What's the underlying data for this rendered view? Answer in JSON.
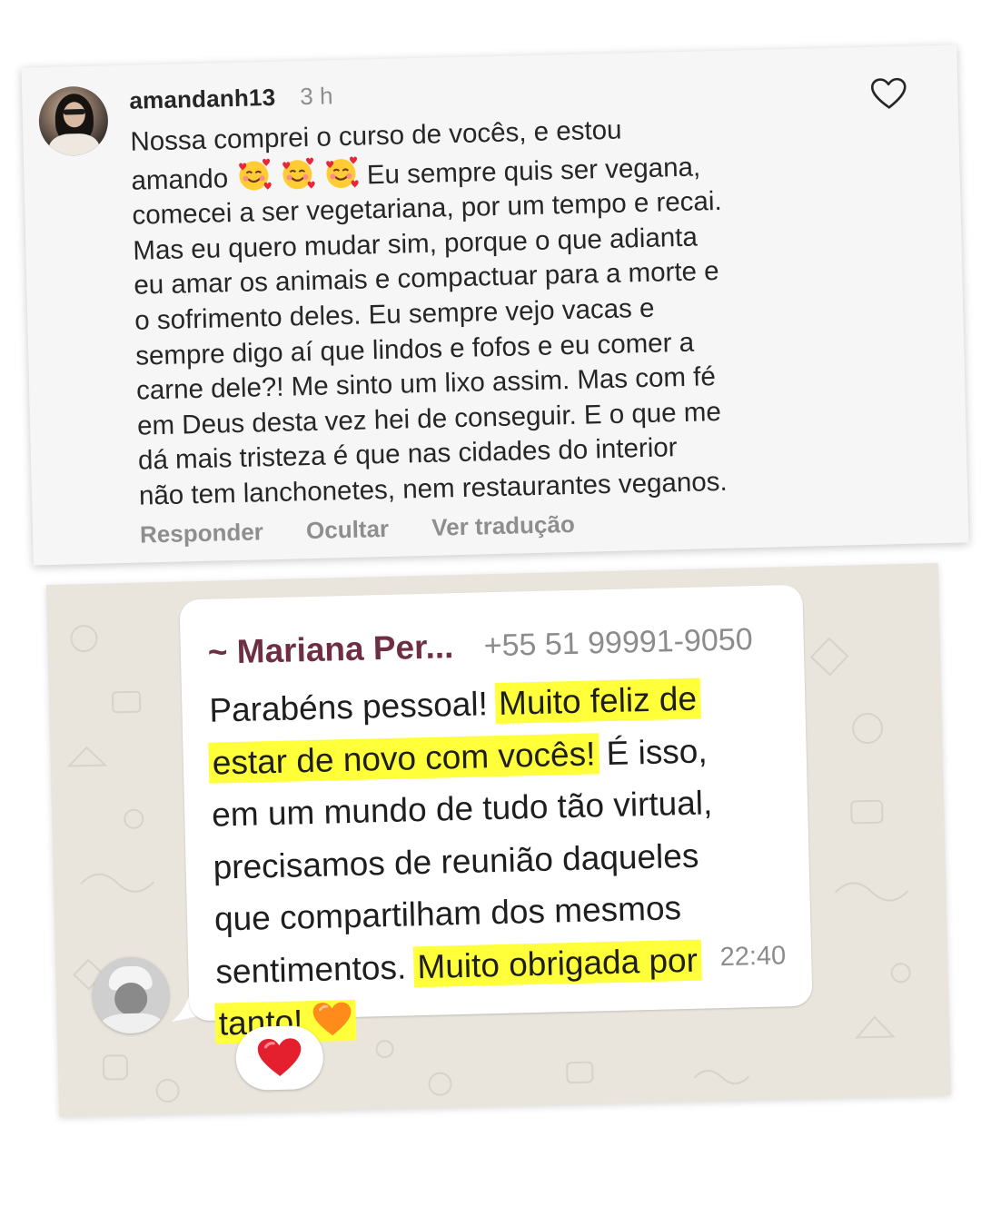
{
  "instagram_comment": {
    "username": "amandanh13",
    "time": "3 h",
    "text_lines": [
      "Nossa comprei o curso de vocês, e estou",
      "amando",
      "Eu sempre quis ser vegana,",
      "comecei a ser vegetariana, por um tempo e recai.",
      "Mas eu quero mudar sim, porque o que adianta",
      "eu amar os animais e compactuar para a morte e",
      "o sofrimento deles. Eu sempre vejo vacas e",
      "sempre digo aí que lindos e fofos e eu comer a",
      "carne dele?! Me sinto um lixo assim. Mas com fé",
      "em Deus desta vez hei de conseguir. E o que me",
      "dá mais tristeza é que nas cidades do interior",
      "não tem lanchonetes, nem restaurantes veganos."
    ],
    "emoji_names": [
      "smiling-face-with-hearts",
      "smiling-face-with-hearts",
      "smiling-face-with-hearts"
    ],
    "actions": {
      "reply": "Responder",
      "hide": "Ocultar",
      "translate": "Ver tradução"
    },
    "icons": {
      "like": "heart-outline-icon"
    }
  },
  "whatsapp_message": {
    "sender": "~ Mariana Per...",
    "phone": "+55 51 99991-9050",
    "segments": {
      "l1_a": "Parabéns pessoal!",
      "l1_b": "Muito feliz de",
      "l2_a": "estar de novo com vocês!",
      "l2_b": "É isso,",
      "l3": "em um mundo de tudo tão virtual,",
      "l4": "precisamos de reunião daqueles",
      "l5": "que compartilham dos mesmos",
      "l6_a": "sentimentos.",
      "l6_b": "Muito obrigada por",
      "l7": "tanto!"
    },
    "time": "22:40",
    "reaction": "red-heart",
    "highlight_color": "#ffff3a",
    "sender_color": "#6e2f45"
  }
}
